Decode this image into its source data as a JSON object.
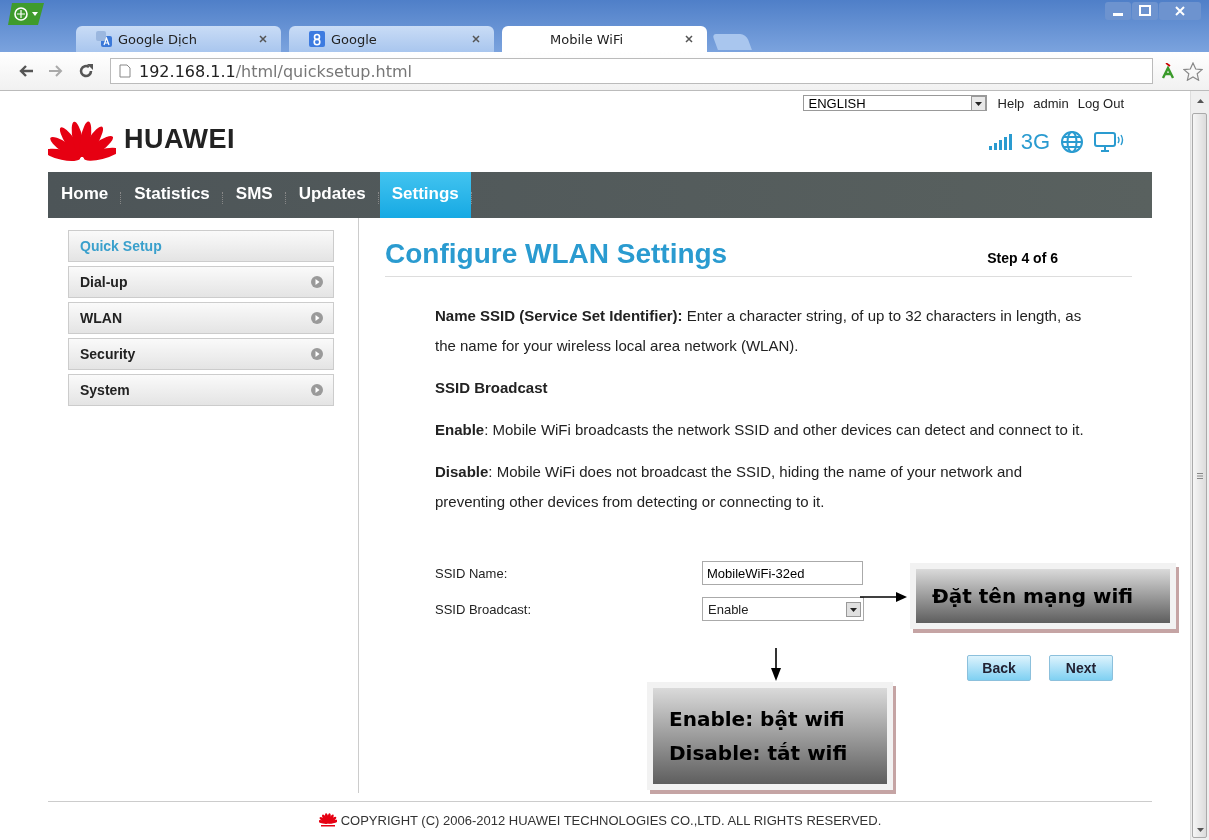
{
  "browser": {
    "tabs": [
      {
        "title": "Google Dịch",
        "selected": false
      },
      {
        "title": "Google",
        "selected": false
      },
      {
        "title": "Mobile WiFi",
        "selected": true
      }
    ],
    "url_host": "192.168.1.1",
    "url_path": "/html/quicksetup.html"
  },
  "header": {
    "language": "ENGLISH",
    "links": [
      "Help",
      "admin",
      "Log Out"
    ],
    "brand": "HUAWEI",
    "network": "3G"
  },
  "nav": [
    {
      "label": "Home",
      "selected": false
    },
    {
      "label": "Statistics",
      "selected": false
    },
    {
      "label": "SMS",
      "selected": false
    },
    {
      "label": "Updates",
      "selected": false
    },
    {
      "label": "Settings",
      "selected": true
    }
  ],
  "sidebar": [
    {
      "label": "Quick Setup",
      "selected": true,
      "expandable": false
    },
    {
      "label": "Dial-up",
      "selected": false,
      "expandable": true
    },
    {
      "label": "WLAN",
      "selected": false,
      "expandable": true
    },
    {
      "label": "Security",
      "selected": false,
      "expandable": true
    },
    {
      "label": "System",
      "selected": false,
      "expandable": true
    }
  ],
  "page": {
    "title": "Configure WLAN Settings",
    "step": "Step 4 of 6",
    "paragraphs": [
      {
        "kind": "text",
        "text": "**Name SSID (Service Set Identifier):** Enter a character string, of up to 32 characters in length, as the name for your wireless local area network (WLAN)."
      },
      {
        "kind": "heading",
        "text": "SSID Broadcast"
      },
      {
        "kind": "text",
        "text": "**Enable**: Mobile WiFi broadcasts the network SSID and other devices can detect and connect to it."
      },
      {
        "kind": "text",
        "text": "**Disable**: Mobile WiFi does not broadcast the SSID, hiding the name of your network and preventing other devices from detecting or connecting to it."
      }
    ],
    "fields": [
      {
        "kind": "text",
        "label": "SSID Name:",
        "value": "MobileWiFi-32ed"
      },
      {
        "kind": "select",
        "label": "SSID Broadcast:",
        "value": "Enable"
      }
    ],
    "buttons": [
      "Back",
      "Next"
    ]
  },
  "annotations": [
    {
      "lines": [
        "Đặt tên mạng wifi"
      ]
    },
    {
      "lines": [
        "Enable: bật wifi",
        "Disable: tắt wifi"
      ]
    }
  ],
  "footer": "COPYRIGHT (C) 2006-2012 HUAWEI TECHNOLOGIES CO.,LTD. ALL RIGHTS RESERVED."
}
